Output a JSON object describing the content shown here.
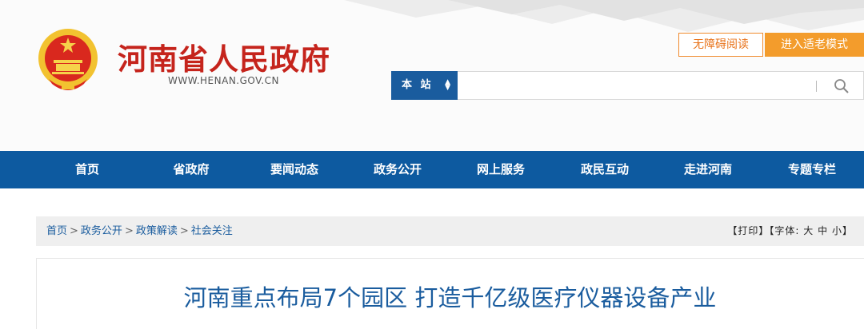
{
  "header": {
    "site_title": "河南省人民政府",
    "site_url": "WWW.HENAN.GOV.CN",
    "emblem_icon": "national-emblem-icon",
    "accessibility_button": "无障碍阅读",
    "elder_mode_button": "进入适老模式",
    "search_scope": "本 站",
    "search_placeholder": "",
    "colors": {
      "title_red": "#c5241c",
      "primary_blue": "#0d5aa0",
      "accent_orange": "#f39c2c"
    }
  },
  "nav": {
    "items": [
      "首页",
      "省政府",
      "要闻动态",
      "政务公开",
      "网上服务",
      "政民互动",
      "走进河南",
      "专题专栏"
    ]
  },
  "breadcrumb": {
    "items": [
      "首页",
      "政务公开",
      "政策解读",
      "社会关注"
    ],
    "separator": ">"
  },
  "tools": {
    "print": "【打印】",
    "font_label": "【字体:",
    "font_large": "大",
    "font_medium": "中",
    "font_small": "小",
    "font_close": "】"
  },
  "article": {
    "title": "河南重点布局7个园区 打造千亿级医疗仪器设备产业"
  }
}
